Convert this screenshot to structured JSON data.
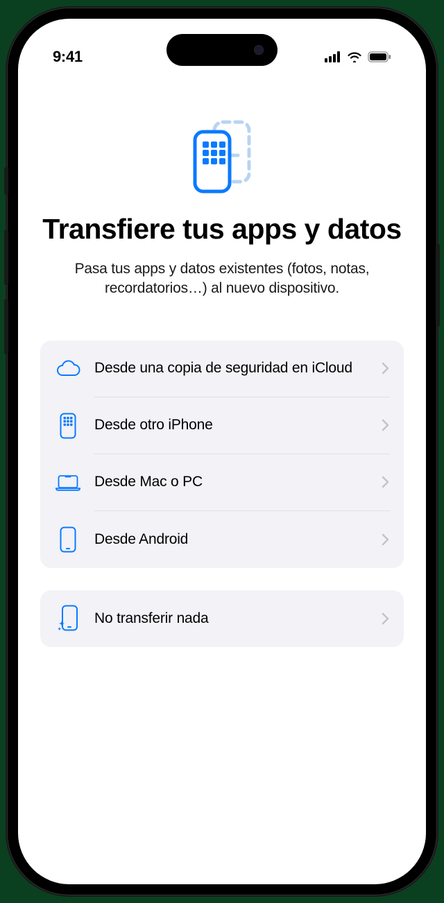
{
  "statusBar": {
    "time": "9:41"
  },
  "header": {
    "title": "Transfiere tus apps y datos",
    "subtitle": "Pasa tus apps y datos existentes (fotos, notas, recordatorios…) al nuevo dispositivo."
  },
  "options": {
    "group1": [
      {
        "icon": "cloud-icon",
        "label": "Desde una copia de seguridad en iCloud"
      },
      {
        "icon": "iphone-grid-icon",
        "label": "Desde otro iPhone"
      },
      {
        "icon": "laptop-icon",
        "label": "Desde Mac o PC"
      },
      {
        "icon": "phone-icon",
        "label": "Desde Android"
      }
    ],
    "group2": [
      {
        "icon": "phone-sparkle-icon",
        "label": "No transferir nada"
      }
    ]
  },
  "colors": {
    "accent": "#0a7aff",
    "accentLight": "#b8d4f0",
    "grouped": "#f2f2f7"
  }
}
